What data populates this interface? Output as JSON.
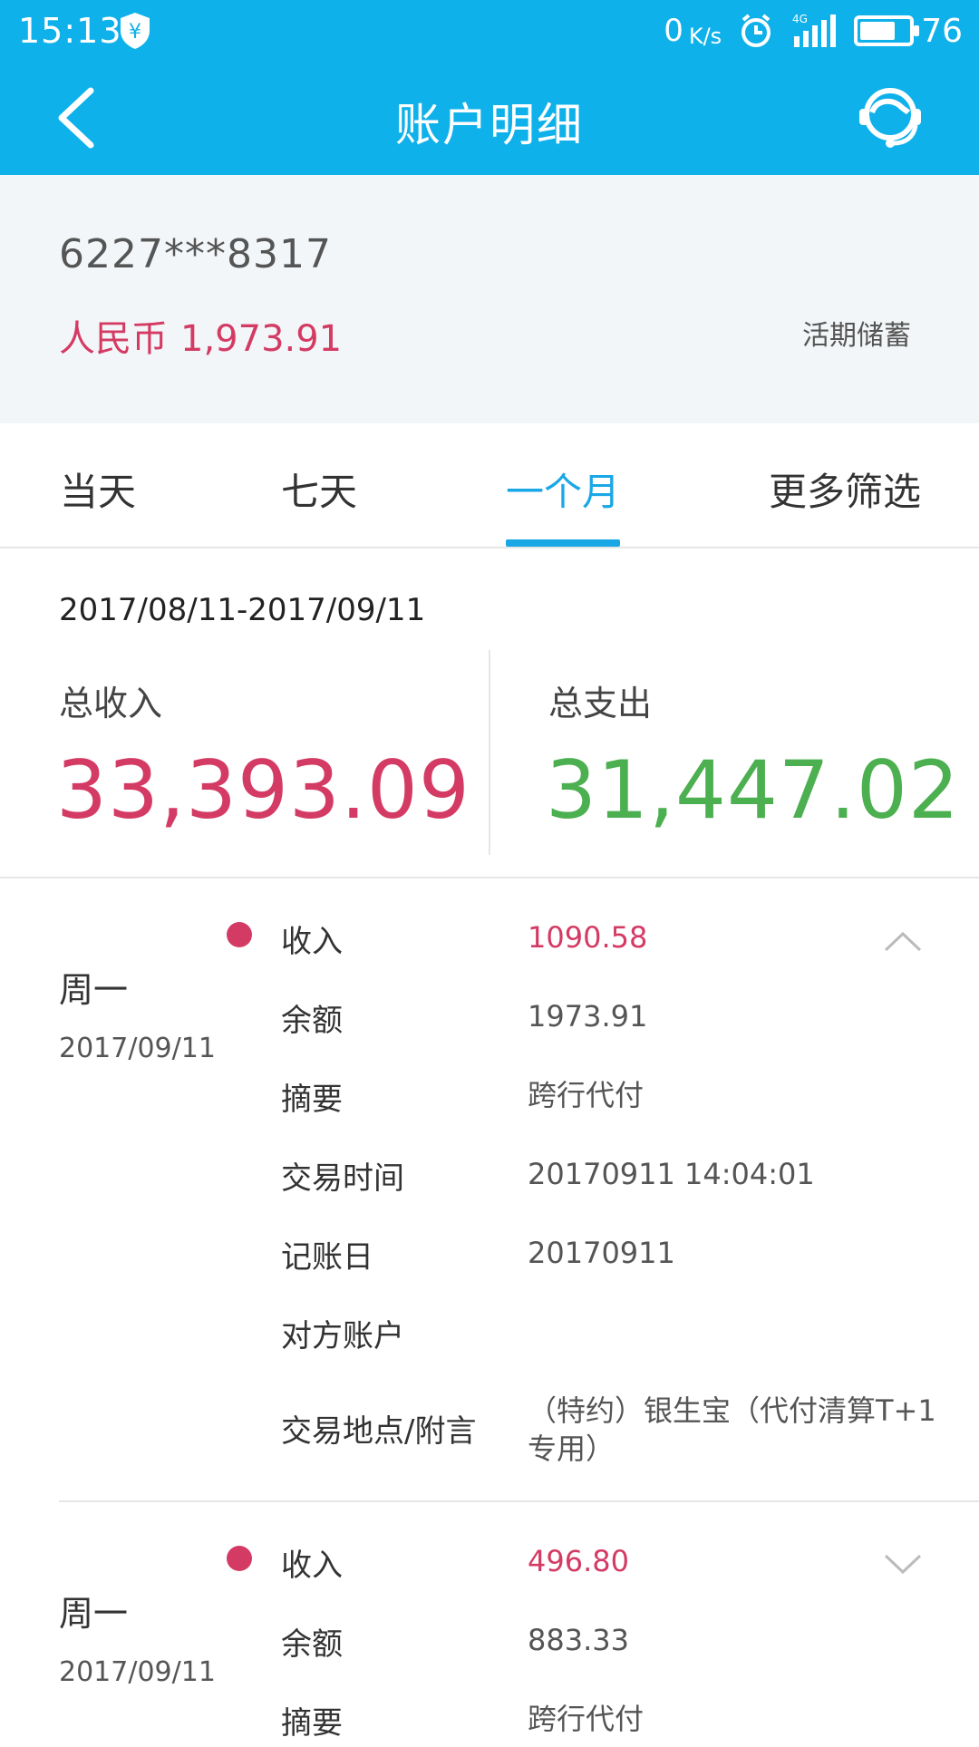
{
  "status_bar": {
    "time": "15:13",
    "net_speed": "0",
    "net_unit": "K/s",
    "network": "4G",
    "battery": "76",
    "battery_level": 0.76
  },
  "header": {
    "title": "账户明细",
    "back_icon": "chevron-left-icon",
    "service_icon": "customer-service-icon"
  },
  "account": {
    "card_no": "6227***8317",
    "currency": "人民币",
    "balance": "1,973.91",
    "type": "活期储蓄"
  },
  "tabs": [
    {
      "label": "当天",
      "active": false
    },
    {
      "label": "七天",
      "active": false
    },
    {
      "label": "一个月",
      "active": true
    },
    {
      "label": "更多筛选",
      "active": false
    }
  ],
  "summary": {
    "date_range": "2017/08/11-2017/09/11",
    "income_label": "总收入",
    "income_value": "33,393.09",
    "expense_label": "总支出",
    "expense_value": "31,447.02"
  },
  "transactions": [
    {
      "day": "周一",
      "date": "2017/09/11",
      "expanded": true,
      "fields": [
        {
          "label": "收入",
          "value": "1090.58"
        },
        {
          "label": "余额",
          "value": "1973.91"
        },
        {
          "label": "摘要",
          "value": "跨行代付"
        },
        {
          "label": "交易时间",
          "value": "20170911 14:04:01"
        },
        {
          "label": "记账日",
          "value": "20170911"
        },
        {
          "label": "对方账户",
          "value": ""
        },
        {
          "label": "交易地点/附言",
          "value": "（特约）银生宝（代付清算T+1专用）"
        }
      ]
    },
    {
      "day": "周一",
      "date": "2017/09/11",
      "expanded": false,
      "fields": [
        {
          "label": "收入",
          "value": "496.80"
        },
        {
          "label": "余额",
          "value": "883.33"
        },
        {
          "label": "摘要",
          "value": "跨行代付"
        }
      ]
    }
  ]
}
